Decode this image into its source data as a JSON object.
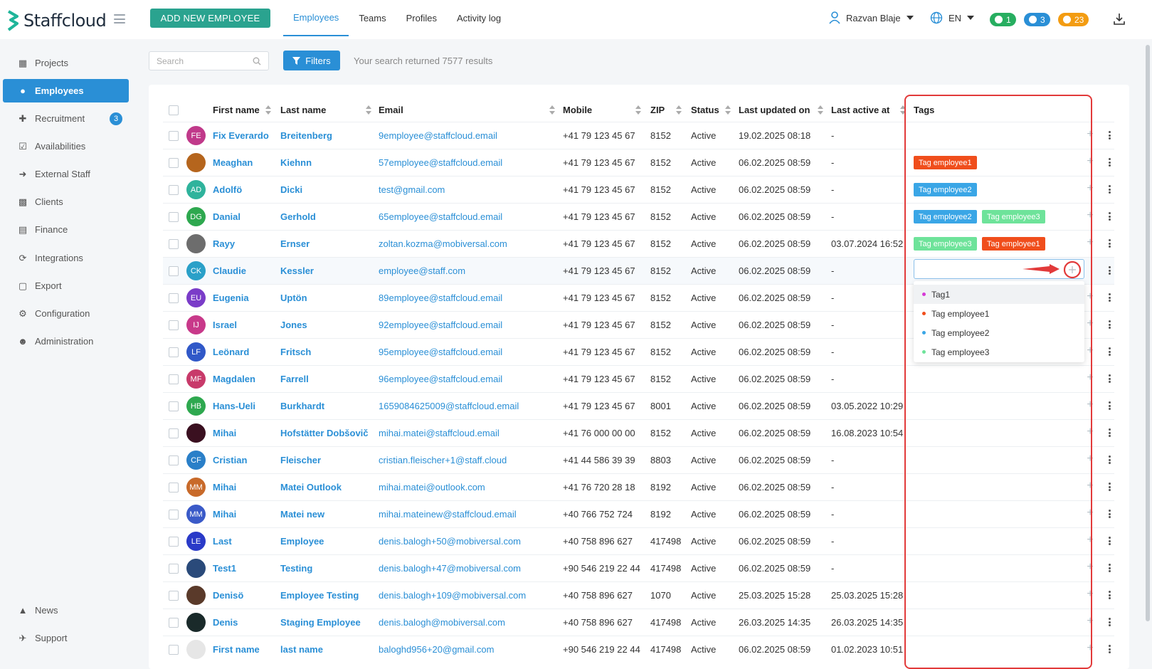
{
  "app": {
    "name": "Staffcloud"
  },
  "header": {
    "add_button": "ADD NEW EMPLOYEE",
    "tabs": [
      {
        "label": "Employees",
        "active": true
      },
      {
        "label": "Teams"
      },
      {
        "label": "Profiles"
      },
      {
        "label": "Activity log"
      }
    ],
    "user_name": "Razvan Blaje",
    "language": "EN",
    "badges": [
      {
        "icon": "chat-icon",
        "count": "1",
        "color": "#27ae60"
      },
      {
        "icon": "bell-icon",
        "count": "3",
        "color": "#2a8fd6"
      },
      {
        "icon": "coin-icon",
        "count": "23",
        "color": "#f39c12"
      }
    ]
  },
  "sidebar": {
    "items": [
      {
        "label": "Projects",
        "icon": "sitemap-icon"
      },
      {
        "label": "Employees",
        "icon": "users-icon",
        "active": true
      },
      {
        "label": "Recruitment",
        "icon": "user-plus-icon",
        "badge": "3"
      },
      {
        "label": "Availabilities",
        "icon": "calendar-check-icon"
      },
      {
        "label": "External Staff",
        "icon": "sign-in-icon"
      },
      {
        "label": "Clients",
        "icon": "building-icon"
      },
      {
        "label": "Finance",
        "icon": "money-icon"
      },
      {
        "label": "Integrations",
        "icon": "sync-icon"
      },
      {
        "label": "Export",
        "icon": "file-icon"
      },
      {
        "label": "Configuration",
        "icon": "cog-icon"
      },
      {
        "label": "Administration",
        "icon": "user-cog-icon"
      }
    ],
    "bottom": [
      {
        "label": "News",
        "icon": "megaphone-icon"
      },
      {
        "label": "Support",
        "icon": "comments-icon"
      }
    ]
  },
  "toolbar": {
    "search_placeholder": "Search",
    "filters_label": "Filters",
    "results_text": "Your search returned 7577 results"
  },
  "table": {
    "headers": [
      "First name",
      "Last name",
      "Email",
      "Mobile",
      "ZIP",
      "Status",
      "Last updated on",
      "Last active at",
      "Tags"
    ],
    "rows": [
      {
        "initials": "FE",
        "av": "#c0398a",
        "first": "Fix Everardo",
        "last": "Breitenberg",
        "email": "9employee@staffcloud.email",
        "mobile": "+41 79 123 45 67",
        "zip": "8152",
        "status": "Active",
        "updated": "19.02.2025 08:18",
        "active": "-",
        "tags": []
      },
      {
        "initials": "",
        "av": "#b5651d",
        "photo": true,
        "first": "Meaghan",
        "last": "Kiehnn",
        "email": "57employee@staffcloud.email",
        "mobile": "+41 79 123 45 67",
        "zip": "8152",
        "status": "Active",
        "updated": "06.02.2025 08:59",
        "active": "-",
        "tags": [
          {
            "label": "Tag employee1",
            "color": "#f04e1c"
          }
        ]
      },
      {
        "initials": "AD",
        "av": "#2fb39c",
        "first": "Adolfö",
        "last": "Dicki",
        "email": "test@gmail.com",
        "mobile": "+41 79 123 45 67",
        "zip": "8152",
        "status": "Active",
        "updated": "06.02.2025 08:59",
        "active": "-",
        "tags": [
          {
            "label": "Tag employee2",
            "color": "#3aa6e6"
          }
        ]
      },
      {
        "initials": "DG",
        "av": "#2ea84f",
        "first": "Danial",
        "last": "Gerhold",
        "email": "65employee@staffcloud.email",
        "mobile": "+41 79 123 45 67",
        "zip": "8152",
        "status": "Active",
        "updated": "06.02.2025 08:59",
        "active": "-",
        "tags": [
          {
            "label": "Tag employee2",
            "color": "#3aa6e6"
          },
          {
            "label": "Tag employee3",
            "color": "#6ee39a"
          }
        ]
      },
      {
        "initials": "",
        "av": "#6d6d6d",
        "photo": true,
        "first": "Rayy",
        "last": "Ernser",
        "email": "zoltan.kozma@mobiversal.com",
        "mobile": "+41 79 123 45 67",
        "zip": "8152",
        "status": "Active",
        "updated": "06.02.2025 08:59",
        "active": "03.07.2024 16:52",
        "tags": [
          {
            "label": "Tag employee3",
            "color": "#6ee39a"
          },
          {
            "label": "Tag employee1",
            "color": "#f04e1c"
          }
        ]
      },
      {
        "initials": "CK",
        "av": "#2aa0c8",
        "first": "Claudie",
        "last": "Kessler",
        "email": "employee@staff.com",
        "mobile": "+41 79 123 45 67",
        "zip": "8152",
        "status": "Active",
        "updated": "06.02.2025 08:59",
        "active": "-",
        "tags": []
      },
      {
        "initials": "EU",
        "av": "#7a3cc8",
        "first": "Eugenia",
        "last": "Uptön",
        "email": "89employee@staffcloud.email",
        "mobile": "+41 79 123 45 67",
        "zip": "8152",
        "status": "Active",
        "updated": "06.02.2025 08:59",
        "active": "-",
        "tags": []
      },
      {
        "initials": "IJ",
        "av": "#c8398a",
        "first": "Israel",
        "last": "Jones",
        "email": "92employee@staffcloud.email",
        "mobile": "+41 79 123 45 67",
        "zip": "8152",
        "status": "Active",
        "updated": "06.02.2025 08:59",
        "active": "-",
        "tags": []
      },
      {
        "initials": "LF",
        "av": "#3058c8",
        "first": "Leönard",
        "last": "Fritsch",
        "email": "95employee@staffcloud.email",
        "mobile": "+41 79 123 45 67",
        "zip": "8152",
        "status": "Active",
        "updated": "06.02.2025 08:59",
        "active": "-",
        "tags": []
      },
      {
        "initials": "MF",
        "av": "#c83a6a",
        "first": "Magdalen",
        "last": "Farrell",
        "email": "96employee@staffcloud.email",
        "mobile": "+41 79 123 45 67",
        "zip": "8152",
        "status": "Active",
        "updated": "06.02.2025 08:59",
        "active": "-",
        "tags": []
      },
      {
        "initials": "HB",
        "av": "#2ea84f",
        "first": "Hans-Ueli",
        "last": "Burkhardt",
        "email": "1659084625009@staffcloud.email",
        "mobile": "+41 79 123 45 67",
        "zip": "8001",
        "status": "Active",
        "updated": "06.02.2025 08:59",
        "active": "03.05.2022 10:29",
        "tags": []
      },
      {
        "initials": "",
        "av": "#3a1020",
        "photo": true,
        "first": "Mihai",
        "last": "Hofstätter Dobšovič",
        "email": "mihai.matei@staffcloud.email",
        "mobile": "+41 76 000 00 00",
        "zip": "8152",
        "status": "Active",
        "updated": "06.02.2025 08:59",
        "active": "16.08.2023 10:54",
        "tags": []
      },
      {
        "initials": "CF",
        "av": "#2a7fc8",
        "first": "Cristian",
        "last": "Fleischer",
        "email": "cristian.fleischer+1@staff.cloud",
        "mobile": "+41 44 586 39 39",
        "zip": "8803",
        "status": "Active",
        "updated": "06.02.2025 08:59",
        "active": "-",
        "tags": []
      },
      {
        "initials": "MM",
        "av": "#c86a2a",
        "first": "Mihai",
        "last": "Matei Outlook",
        "email": "mihai.matei@outlook.com",
        "mobile": "+41 76 720 28 18",
        "zip": "8192",
        "status": "Active",
        "updated": "06.02.2025 08:59",
        "active": "-",
        "tags": []
      },
      {
        "initials": "MM",
        "av": "#3a5ac8",
        "first": "Mihai",
        "last": "Matei new",
        "email": "mihai.mateinew@staffcloud.email",
        "mobile": "+40 766 752 724",
        "zip": "8192",
        "status": "Active",
        "updated": "06.02.2025 08:59",
        "active": "-",
        "tags": []
      },
      {
        "initials": "LE",
        "av": "#2a3ac8",
        "first": "Last",
        "last": "Employee",
        "email": "denis.balogh+50@mobiversal.com",
        "mobile": "+40 758 896 627",
        "zip": "417498",
        "status": "Active",
        "updated": "06.02.2025 08:59",
        "active": "-",
        "tags": []
      },
      {
        "initials": "",
        "av": "#2a4a7a",
        "photo": true,
        "first": "Test1",
        "last": "Testing",
        "email": "denis.balogh+47@mobiversal.com",
        "mobile": "+90 546 219 22 44",
        "zip": "417498",
        "status": "Active",
        "updated": "06.02.2025 08:59",
        "active": "-",
        "tags": []
      },
      {
        "initials": "",
        "av": "#5a3a2a",
        "photo": true,
        "first": "Denisö",
        "last": "Employee Testing",
        "email": "denis.balogh+109@mobiversal.com",
        "mobile": "+40 758 896 627",
        "zip": "1070",
        "status": "Active",
        "updated": "25.03.2025 15:28",
        "active": "25.03.2025 15:28",
        "tags": []
      },
      {
        "initials": "",
        "av": "#1a2a2a",
        "photo": true,
        "first": "Denis",
        "last": "Staging Employee",
        "email": "denis.balogh@mobiversal.com",
        "mobile": "+40 758 896 627",
        "zip": "417498",
        "status": "Active",
        "updated": "26.03.2025 14:35",
        "active": "26.03.2025 14:35",
        "tags": []
      },
      {
        "initials": "",
        "av": "#e6e6e6",
        "photo": true,
        "first": "First name",
        "last": "last name",
        "email": "baloghd956+20@gmail.com",
        "mobile": "+90 546 219 22 44",
        "zip": "417498",
        "status": "Active",
        "updated": "06.02.2025 08:59",
        "active": "01.02.2023 10:51",
        "tags": []
      }
    ]
  },
  "tag_dropdown": {
    "options": [
      {
        "label": "Tag1",
        "color": "#d63ad6",
        "selected": true
      },
      {
        "label": "Tag employee1",
        "color": "#f04e1c"
      },
      {
        "label": "Tag employee2",
        "color": "#3aa6e6"
      },
      {
        "label": "Tag employee3",
        "color": "#6ee39a"
      }
    ]
  }
}
